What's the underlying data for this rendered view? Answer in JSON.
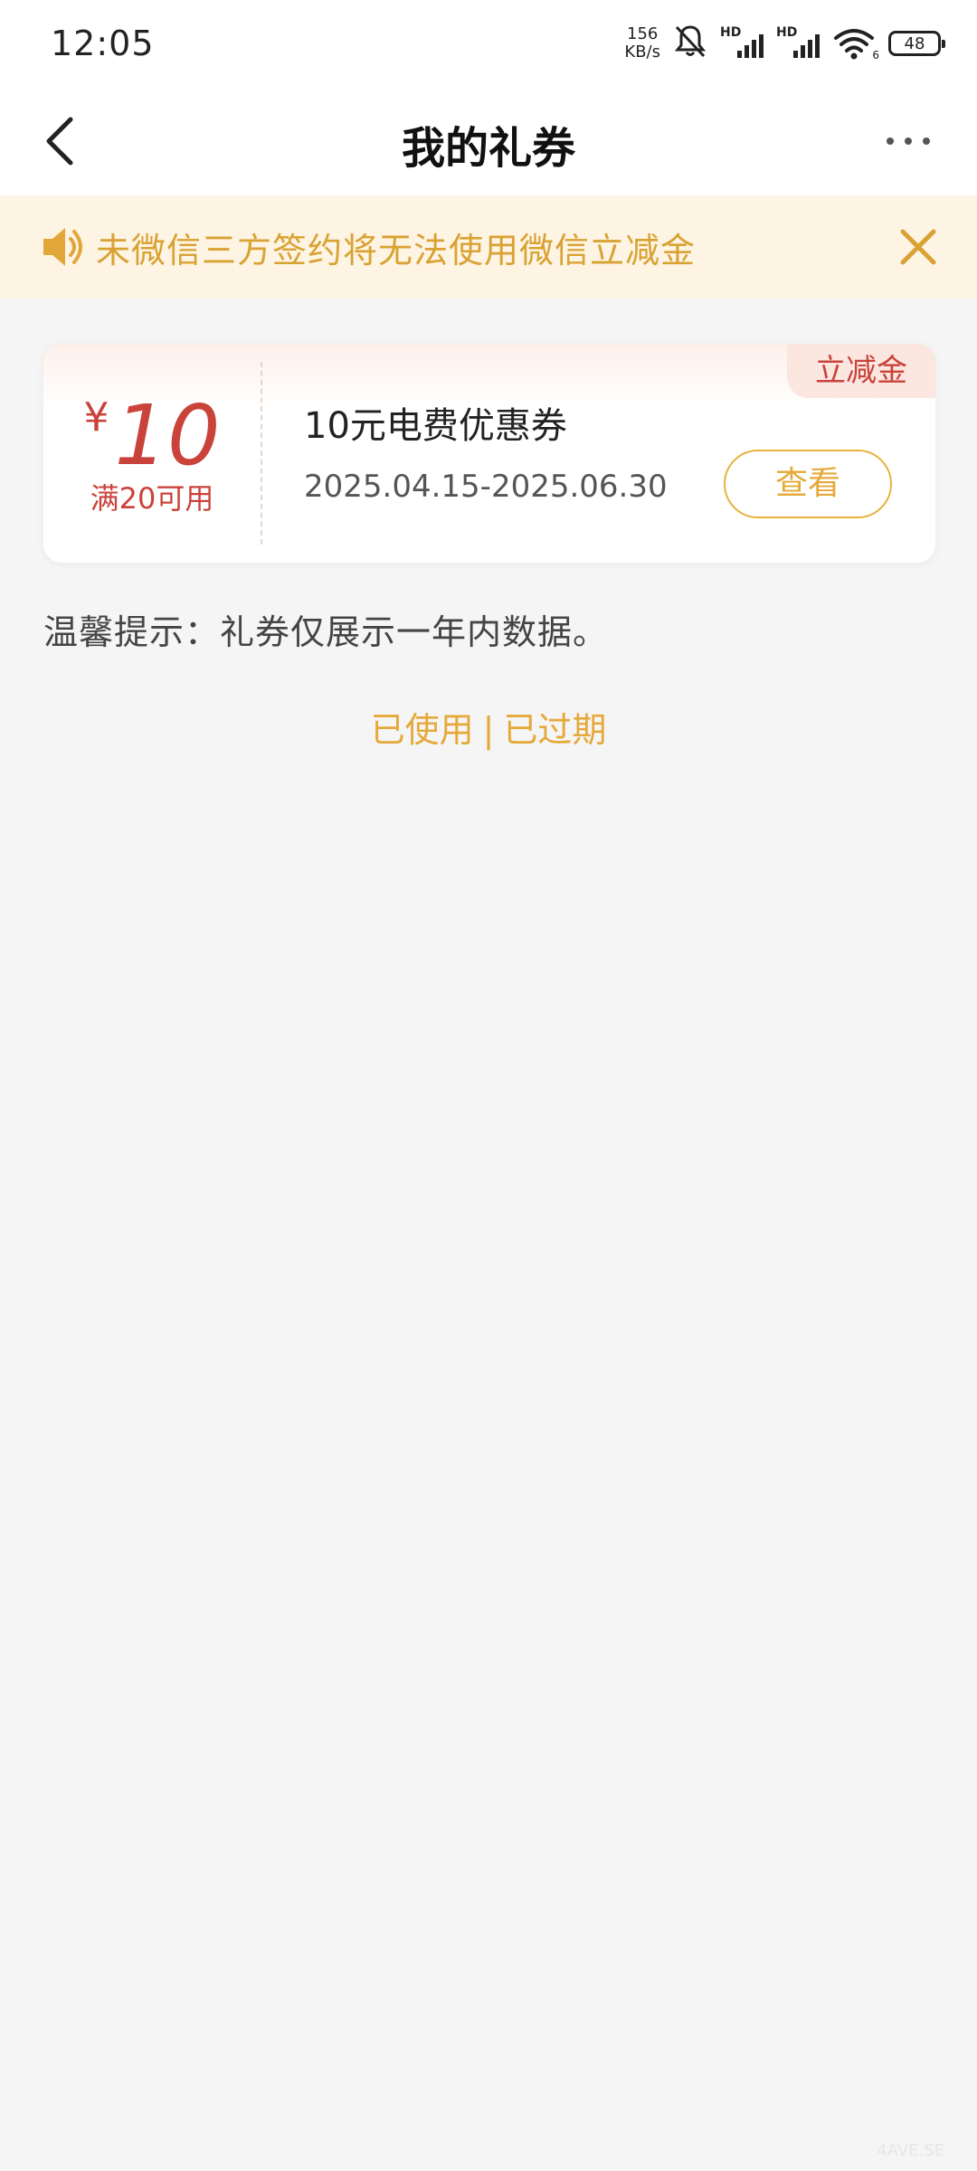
{
  "status_bar": {
    "time": "12:05",
    "net_speed_value": "156",
    "net_speed_unit": "KB/s",
    "signal_1_label": "HD",
    "signal_2_label": "HD",
    "wifi_sub": "6",
    "battery": "48",
    "icons": [
      "bell-muted-icon",
      "signal-icon",
      "wifi-icon",
      "battery-icon"
    ]
  },
  "nav": {
    "title": "我的礼券",
    "back_icon": "chevron-left-icon",
    "more_icon": "more-dots-icon"
  },
  "notice": {
    "text": "未微信三方签约将无法使用微信立减金",
    "color": "#d9a233",
    "icon": "speaker-icon",
    "close_icon": "close-icon"
  },
  "coupons": [
    {
      "tag": "立减金",
      "currency": "¥",
      "amount": "10",
      "condition": "满20可用",
      "name": "10元电费优惠券",
      "date_range": "2025.04.15-2025.06.30",
      "view_label": "查看"
    }
  ],
  "tip": "温馨提示：礼券仅展示一年内数据。",
  "history": {
    "used": "已使用",
    "separator": "|",
    "expired": "已过期"
  },
  "watermark": "4AVE.SE",
  "colors": {
    "accent_red": "#c9433b",
    "accent_gold": "#e5a93a",
    "notice_bg": "#fdf4e3",
    "page_bg": "#f5f5f5"
  }
}
